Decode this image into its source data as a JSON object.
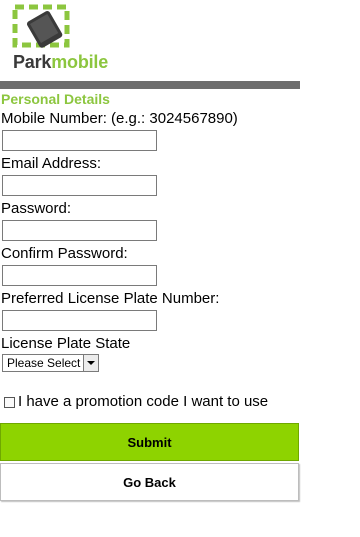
{
  "brand": {
    "name_part1": "Park",
    "name_part2": "mobile",
    "logo_icon": "parking-phone-logo-icon",
    "colors": {
      "accent_green": "#8cc63f",
      "button_green": "#8ed300",
      "header_bar": "#6d6d6d",
      "text_dark": "#3a3a3a"
    }
  },
  "form": {
    "section_title": "Personal Details",
    "fields": [
      {
        "label": "Mobile Number: (e.g.: 3024567890)",
        "value": "",
        "placeholder": ""
      },
      {
        "label": "Email Address:",
        "value": "",
        "placeholder": ""
      },
      {
        "label": "Password:",
        "value": "",
        "placeholder": ""
      },
      {
        "label": "Confirm Password:",
        "value": "",
        "placeholder": ""
      },
      {
        "label": "Preferred License Plate Number:",
        "value": "",
        "placeholder": ""
      }
    ],
    "state": {
      "label": "License Plate State",
      "selected": "Please Select"
    },
    "promo": {
      "label": "I have a promotion code I want to use",
      "checked": false
    },
    "submit_label": "Submit",
    "back_label": "Go Back"
  }
}
